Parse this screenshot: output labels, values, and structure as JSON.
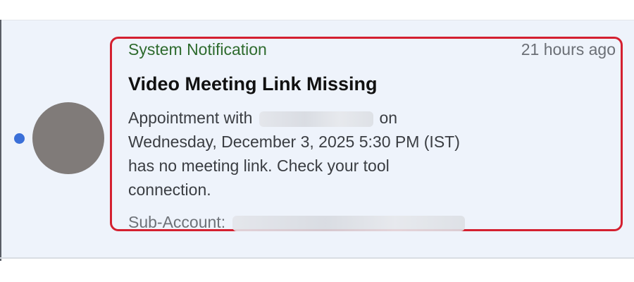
{
  "notification": {
    "category": "System Notification",
    "time": "21 hours ago",
    "title": "Video Meeting Link Missing",
    "body_lines": [
      "Appointment with",
      "on",
      "Wednesday, December 3, 2025 5:30 PM (IST)",
      "has no meeting link. Check your tool",
      "connection."
    ],
    "sub_account_label": "Sub-Account:"
  },
  "avatar": {
    "color": "#807b79"
  },
  "colors": {
    "category": "#2e6b2e",
    "unread_dot": "#3a6fd8",
    "highlight_border": "#d42030"
  }
}
